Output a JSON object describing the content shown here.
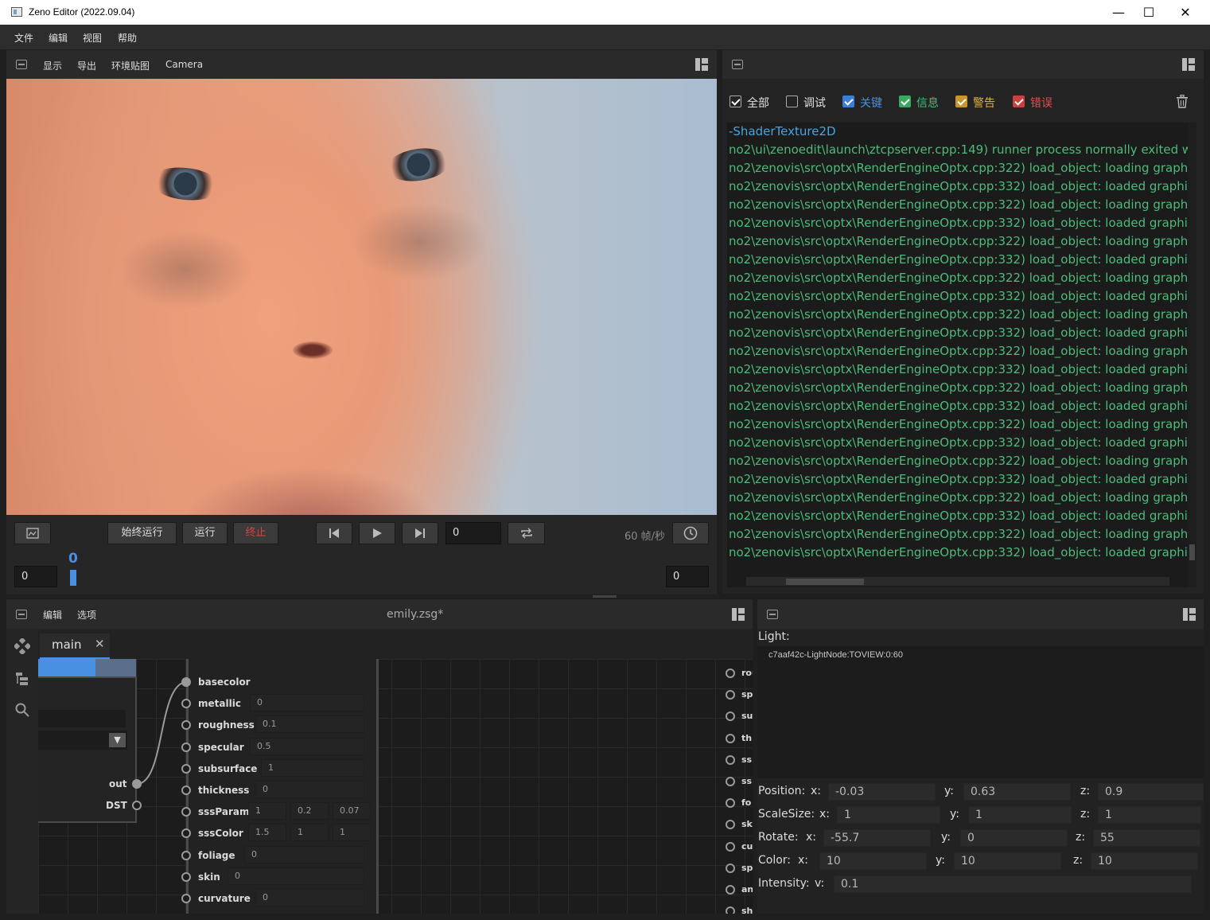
{
  "window": {
    "title": "Zeno Editor (2022.09.04)"
  },
  "menu": {
    "items": [
      "文件",
      "编辑",
      "视图",
      "帮助"
    ]
  },
  "viewport": {
    "tabs": [
      "显示",
      "导出",
      "环境贴图",
      "Camera"
    ],
    "run_always": "始终运行",
    "run": "运行",
    "stop": "终止",
    "frame": "0",
    "fps": "60 帧/秒",
    "timeline": {
      "start": "0",
      "end": "0",
      "current": "0",
      "progress": 0
    }
  },
  "log": {
    "filters": [
      {
        "label": "全部",
        "checked": true,
        "color": "#e0e0e0",
        "box": "none"
      },
      {
        "label": "调试",
        "checked": false,
        "color": "#e0e0e0",
        "box": "none"
      },
      {
        "label": "关键",
        "checked": true,
        "color": "#4a90e2",
        "box": "#3a7fd5"
      },
      {
        "label": "信息",
        "checked": true,
        "color": "#4dbb7a",
        "box": "#3aa860"
      },
      {
        "label": "警告",
        "checked": true,
        "color": "#e0b040",
        "box": "#c9952d"
      },
      {
        "label": "错误",
        "checked": true,
        "color": "#e05050",
        "box": "#c84040"
      }
    ],
    "lines": [
      "-ShaderTexture2D",
      "no2\\ui\\zenoedit\\launch\\ztcpserver.cpp:149) runner process normally exited with",
      "no2\\zenovis\\src\\optx\\RenderEngineOptx.cpp:322) load_object: loading graphic",
      "no2\\zenovis\\src\\optx\\RenderEngineOptx.cpp:332) load_object: loaded graphics",
      "no2\\zenovis\\src\\optx\\RenderEngineOptx.cpp:322) load_object: loading graphic",
      "no2\\zenovis\\src\\optx\\RenderEngineOptx.cpp:332) load_object: loaded graphics",
      "no2\\zenovis\\src\\optx\\RenderEngineOptx.cpp:322) load_object: loading graphic",
      "no2\\zenovis\\src\\optx\\RenderEngineOptx.cpp:332) load_object: loaded graphics",
      "no2\\zenovis\\src\\optx\\RenderEngineOptx.cpp:322) load_object: loading graphic",
      "no2\\zenovis\\src\\optx\\RenderEngineOptx.cpp:332) load_object: loaded graphics",
      "no2\\zenovis\\src\\optx\\RenderEngineOptx.cpp:322) load_object: loading graphic",
      "no2\\zenovis\\src\\optx\\RenderEngineOptx.cpp:332) load_object: loaded graphics",
      "no2\\zenovis\\src\\optx\\RenderEngineOptx.cpp:322) load_object: loading graphic",
      "no2\\zenovis\\src\\optx\\RenderEngineOptx.cpp:332) load_object: loaded graphics",
      "no2\\zenovis\\src\\optx\\RenderEngineOptx.cpp:322) load_object: loading graphic",
      "no2\\zenovis\\src\\optx\\RenderEngineOptx.cpp:332) load_object: loaded graphics",
      "no2\\zenovis\\src\\optx\\RenderEngineOptx.cpp:322) load_object: loading graphic",
      "no2\\zenovis\\src\\optx\\RenderEngineOptx.cpp:332) load_object: loaded graphics",
      "no2\\zenovis\\src\\optx\\RenderEngineOptx.cpp:322) load_object: loading graphic",
      "no2\\zenovis\\src\\optx\\RenderEngineOptx.cpp:332) load_object: loaded graphics",
      "no2\\zenovis\\src\\optx\\RenderEngineOptx.cpp:322) load_object: loading graphic",
      "no2\\zenovis\\src\\optx\\RenderEngineOptx.cpp:332) load_object: loaded graphics",
      "no2\\zenovis\\src\\optx\\RenderEngineOptx.cpp:322) load_object: loading graphic",
      "no2\\zenovis\\src\\optx\\RenderEngineOptx.cpp:332) load_object: loaded graphics"
    ]
  },
  "editor": {
    "tabs": [
      "编辑",
      "选项"
    ],
    "file": "emily.zsg*",
    "graph_tab": "main",
    "node_left": {
      "outputs": [
        "out",
        "DST"
      ]
    },
    "sockets": [
      {
        "name": "basecolor",
        "values": []
      },
      {
        "name": "metallic",
        "values": [
          "0"
        ]
      },
      {
        "name": "roughness",
        "values": [
          "0.1"
        ]
      },
      {
        "name": "specular",
        "values": [
          "0.5"
        ]
      },
      {
        "name": "subsurface",
        "values": [
          "1"
        ]
      },
      {
        "name": "thickness",
        "values": [
          "0"
        ]
      },
      {
        "name": "sssParam",
        "values": [
          "1",
          "0.2",
          "0.07"
        ]
      },
      {
        "name": "sssColor",
        "values": [
          "1.5",
          "1",
          "1"
        ]
      },
      {
        "name": "foliage",
        "values": [
          "0"
        ]
      },
      {
        "name": "skin",
        "values": [
          "0"
        ]
      },
      {
        "name": "curvature",
        "values": [
          "0"
        ]
      }
    ],
    "right_sockets": [
      "rou",
      "sp",
      "su",
      "th",
      "ss",
      "ss",
      "fo",
      "sk",
      "cu",
      "sp",
      "an",
      "sh"
    ]
  },
  "properties": {
    "title": "Light:",
    "node_id": "c7aaf42c-LightNode:TOVIEW:0:60",
    "rows": [
      {
        "label": "Position:",
        "fields": [
          {
            "axis": "x:",
            "value": "-0.03"
          },
          {
            "axis": "y:",
            "value": "0.63"
          },
          {
            "axis": "z:",
            "value": "0.9"
          }
        ]
      },
      {
        "label": "ScaleSize:",
        "fields": [
          {
            "axis": "x:",
            "value": "1"
          },
          {
            "axis": "y:",
            "value": "1"
          },
          {
            "axis": "z:",
            "value": "1"
          }
        ]
      },
      {
        "label": "Rotate:",
        "fields": [
          {
            "axis": "x:",
            "value": "-55.7"
          },
          {
            "axis": "y:",
            "value": "0"
          },
          {
            "axis": "z:",
            "value": "55"
          }
        ]
      },
      {
        "label": "Color:",
        "fields": [
          {
            "axis": "x:",
            "value": "10"
          },
          {
            "axis": "y:",
            "value": "10"
          },
          {
            "axis": "z:",
            "value": "10"
          }
        ]
      },
      {
        "label": "Intensity:",
        "fields": [
          {
            "axis": "v:",
            "value": "0.1"
          }
        ]
      }
    ]
  }
}
